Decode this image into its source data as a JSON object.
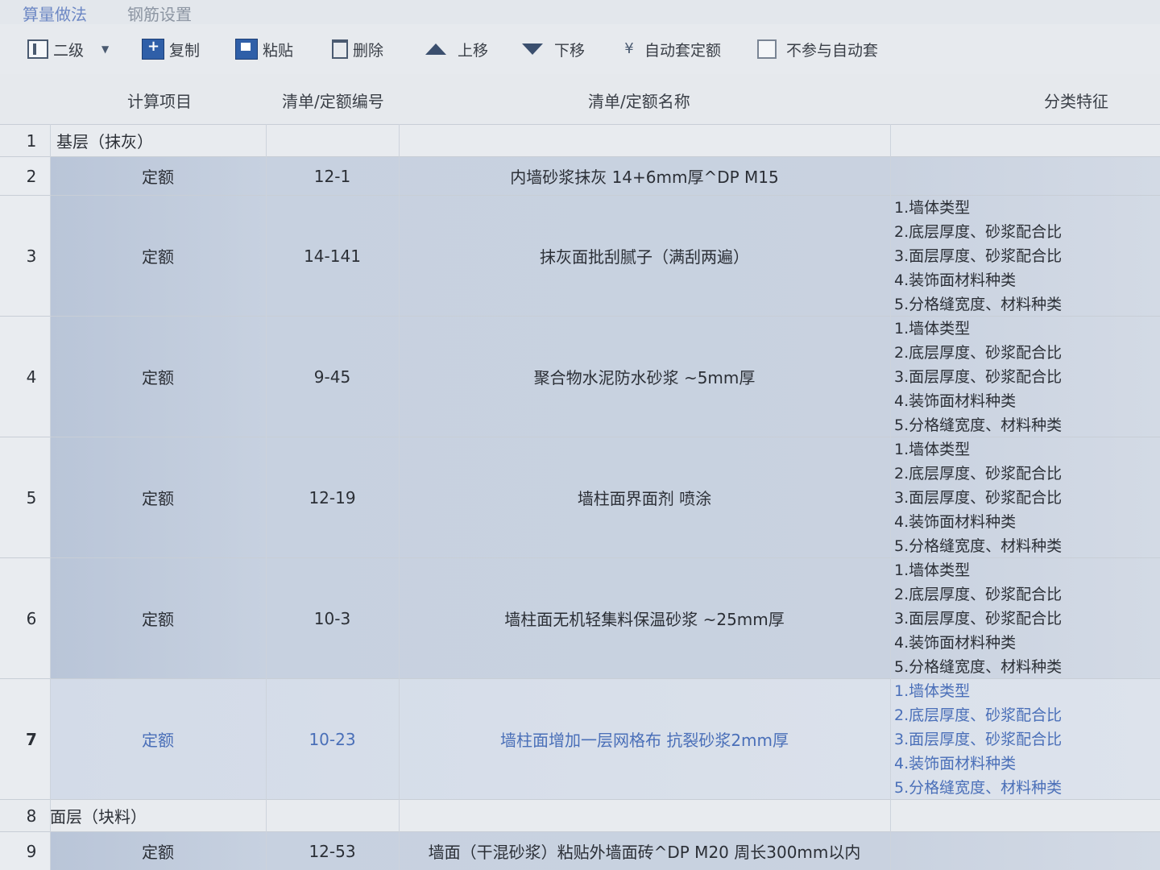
{
  "tabs": [
    "算量做法",
    "钢筋设置"
  ],
  "toolbar": {
    "level": "二级",
    "copy": "复制",
    "paste": "粘贴",
    "delete": "删除",
    "move_up": "上移",
    "move_down": "下移",
    "auto_quota": "自动套定额",
    "exclude_auto": "不参与自动套"
  },
  "columns": {
    "calc_item": "计算项目",
    "code": "清单/定额编号",
    "name": "清单/定额名称",
    "feature": "分类特征"
  },
  "features": [
    "1.墙体类型",
    "2.底层厚度、砂浆配合比",
    "3.面层厚度、砂浆配合比",
    "4.装饰面材料种类",
    "5.分格缝宽度、材料种类"
  ],
  "rows": [
    {
      "num": "1",
      "label": "基层（抹灰）"
    },
    {
      "num": "2",
      "item": "定额",
      "code": "12-1",
      "name": "内墙砂浆抹灰 14+6mm厚^DP M15"
    },
    {
      "num": "3",
      "item": "定额",
      "code": "14-141",
      "name": "抹灰面批刮腻子（满刮两遍）"
    },
    {
      "num": "4",
      "item": "定额",
      "code": "9-45",
      "name": "聚合物水泥防水砂浆 ~5mm厚"
    },
    {
      "num": "5",
      "item": "定额",
      "code": "12-19",
      "name": "墙柱面界面剂 喷涂"
    },
    {
      "num": "6",
      "item": "定额",
      "code": "10-3",
      "name": "墙柱面无机轻集料保温砂浆 ~25mm厚"
    },
    {
      "num": "7",
      "item": "定额",
      "code": "10-23",
      "name": "墙柱面增加一层网格布 抗裂砂浆2mm厚"
    },
    {
      "num": "8",
      "label": "面层（块料）"
    },
    {
      "num": "9",
      "item": "定额",
      "code": "12-53",
      "name": "墙面（干混砂浆）粘贴外墙面砖^DP M20 周长300mm以内"
    }
  ]
}
